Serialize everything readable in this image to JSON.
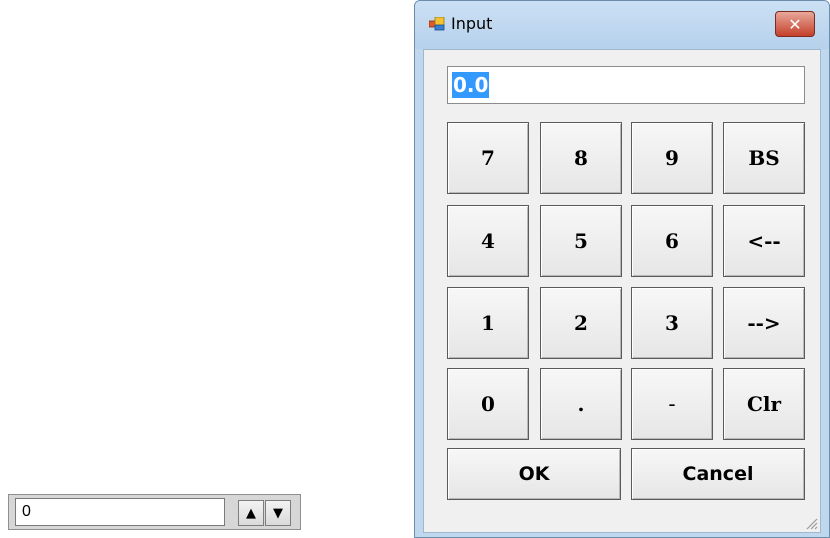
{
  "stepper": {
    "value": "0",
    "up_glyph": "▲",
    "down_glyph": "▼"
  },
  "window": {
    "title": "Input",
    "close_glyph": "✕",
    "icon": "window-app-icon"
  },
  "display": {
    "value": "0.0",
    "selected": true
  },
  "keypad": {
    "row1": [
      "7",
      "8",
      "9",
      "BS"
    ],
    "row2": [
      "4",
      "5",
      "6",
      "<--"
    ],
    "row3": [
      "1",
      "2",
      "3",
      "-->"
    ],
    "row4": [
      "0",
      ".",
      "-",
      "Clr"
    ]
  },
  "actions": {
    "ok_label": "OK",
    "cancel_label": "Cancel"
  },
  "colors": {
    "selection": "#3399ff",
    "titlebar": "#b6d1ec",
    "close": "#c4402a",
    "client": "#f0f0f0"
  }
}
